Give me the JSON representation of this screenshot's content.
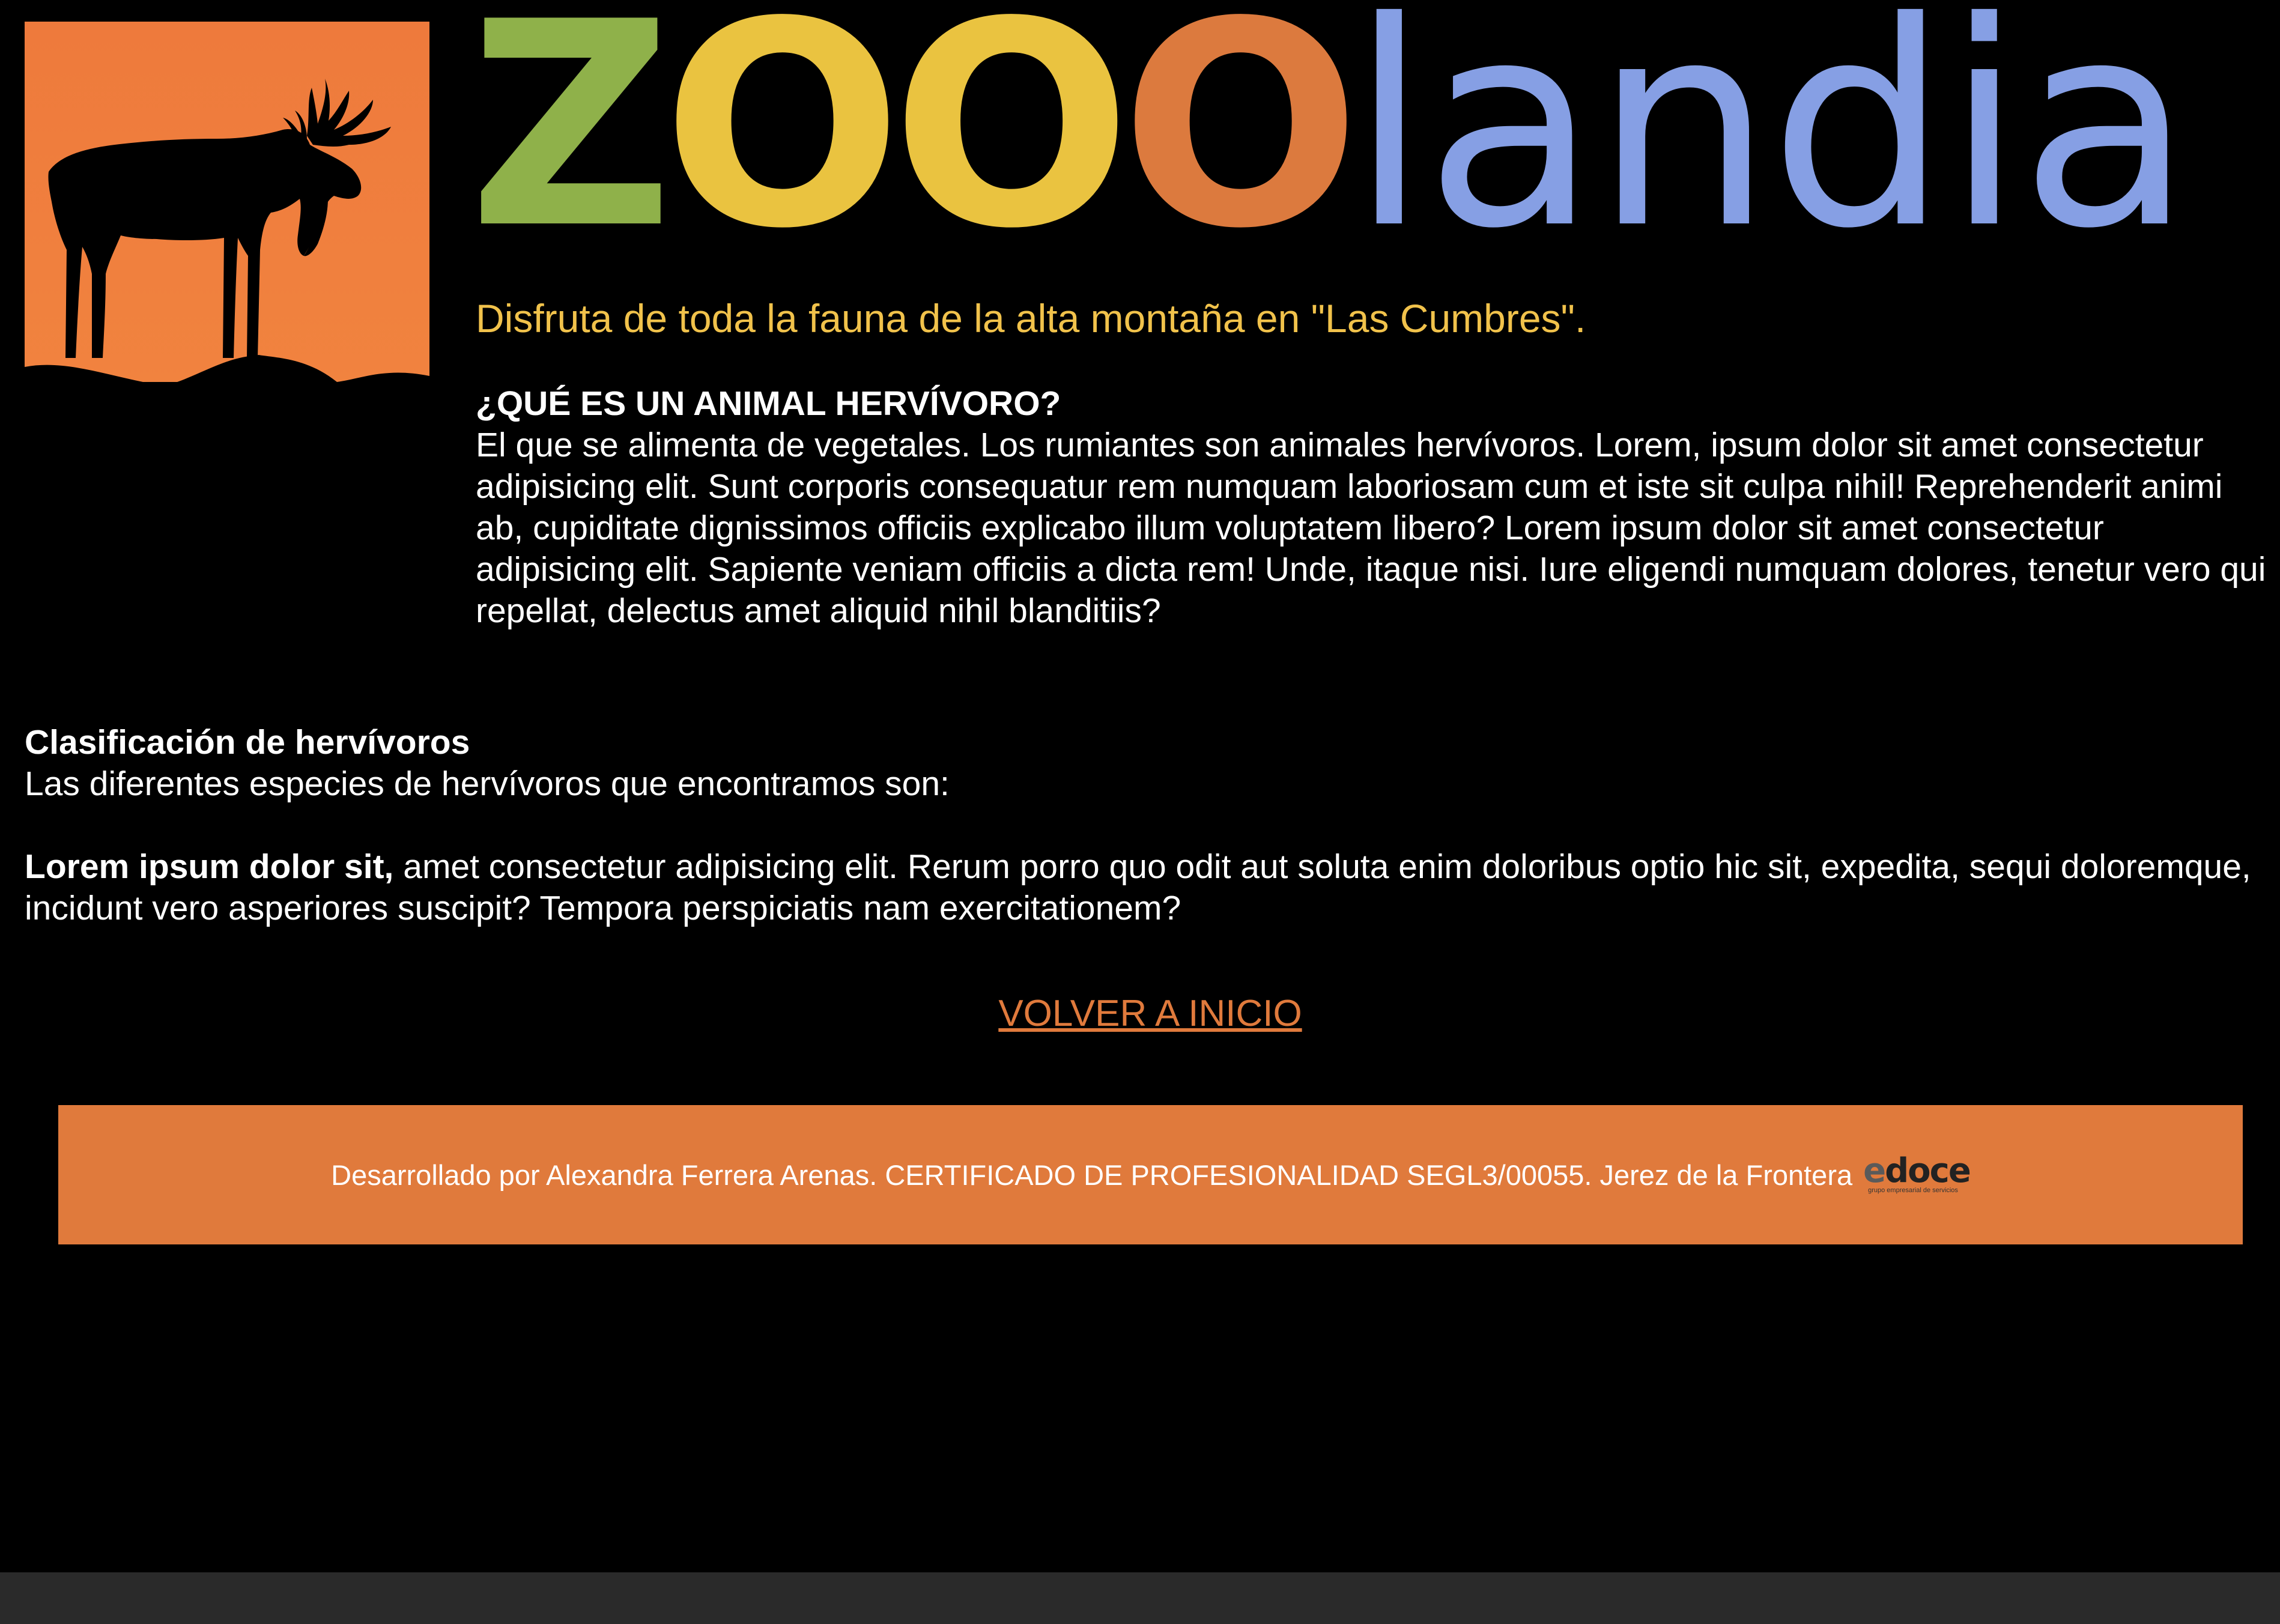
{
  "header": {
    "brand_parts": [
      "Z",
      "OO",
      "O",
      "landia"
    ],
    "tagline": "Disfruta de toda la fauna de la alta montaña en \"Las Cumbres\"."
  },
  "logo": {
    "icon": "moose-silhouette-icon",
    "background_color": "#ee7e3e"
  },
  "intro": {
    "heading": "¿QUÉ ES UN ANIMAL HERVÍVORO?",
    "body": "El que se alimenta de vegetales. Los rumiantes son animales hervívoros. Lorem, ipsum dolor sit amet consectetur adipisicing elit. Sunt corporis consequatur rem numquam laboriosam cum et iste sit culpa nihil! Reprehenderit animi ab, cupiditate dignissimos officiis explicabo illum voluptatem libero? Lorem ipsum dolor sit amet consectetur adipisicing elit. Sapiente veniam officiis a dicta rem! Unde, itaque nisi. Iure eligendi numquam dolores, tenetur vero qui repellat, delectus amet aliquid nihil blanditiis?"
  },
  "classification": {
    "heading": "Clasificación de hervívoros",
    "subtitle": "Las diferentes especies de hervívoros que encontramos son:",
    "item_bold": "Lorem ipsum dolor sit,",
    "item_text": " amet consectetur adipisicing elit. Rerum porro quo odit aut soluta enim doloribus optio hic sit, expedita, sequi doloremque, incidunt vero asperiores suscipit? Tempora perspiciatis nam exercitationem?"
  },
  "nav": {
    "back_link": "VOLVER A INICIO"
  },
  "footer": {
    "text": "Desarrollado por Alexandra Ferrera Arenas. CERTIFICADO DE PROFESIONALIDAD SEGL3/00055. Jerez de la Frontera",
    "logo_prefix": "e",
    "logo_main": "doce",
    "logo_sub": "grupo empresarial de servicios"
  },
  "colors": {
    "background": "#000000",
    "accent_orange": "#e07a3c",
    "tagline_yellow": "#f1c24b",
    "brand_green": "#8fb14a",
    "brand_yellow": "#eac340",
    "brand_orange": "#dc7a3e",
    "brand_blue": "#869fe4"
  }
}
